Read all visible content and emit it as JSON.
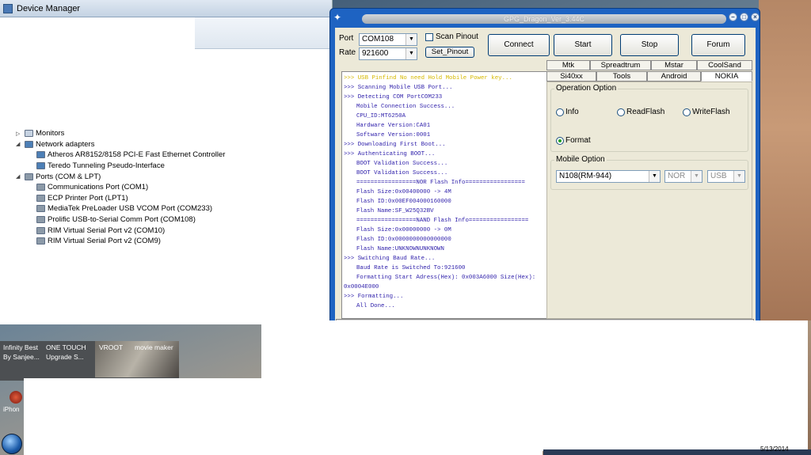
{
  "device_manager": {
    "title": "Device Manager",
    "tree": [
      {
        "label": "Monitors",
        "level": 1,
        "kind": "category",
        "icon": "monitor-icon"
      },
      {
        "label": "Network adapters",
        "level": 1,
        "kind": "category",
        "icon": "network-icon"
      },
      {
        "label": "Atheros AR8152/8158 PCI-E Fast Ethernet Controller",
        "level": 2,
        "kind": "device",
        "icon": "network-card-icon"
      },
      {
        "label": "Teredo Tunneling Pseudo-Interface",
        "level": 2,
        "kind": "device",
        "icon": "network-card-icon"
      },
      {
        "label": "Ports (COM & LPT)",
        "level": 1,
        "kind": "category",
        "icon": "port-icon"
      },
      {
        "label": "Communications Port (COM1)",
        "level": 2,
        "kind": "device",
        "icon": "port-icon"
      },
      {
        "label": "ECP Printer Port (LPT1)",
        "level": 2,
        "kind": "device",
        "icon": "port-icon"
      },
      {
        "label": "MediaTek PreLoader USB VCOM Port (COM233)",
        "level": 2,
        "kind": "device",
        "icon": "port-icon"
      },
      {
        "label": "Prolific USB-to-Serial Comm Port (COM108)",
        "level": 2,
        "kind": "device",
        "icon": "port-icon"
      },
      {
        "label": "RIM Virtual Serial Port v2 (COM10)",
        "level": 2,
        "kind": "device",
        "icon": "port-icon"
      },
      {
        "label": "RIM Virtual Serial Port v2 (COM9)",
        "level": 2,
        "kind": "device",
        "icon": "port-icon"
      }
    ]
  },
  "gpg": {
    "title": "GPG_Dragon_Ver_3.44C",
    "port_label": "Port",
    "port_value": "COM108",
    "rate_label": "Rate",
    "rate_value": "921600",
    "scan_pinout_label": "Scan Pinout",
    "set_pinout_label": "Set_Pinout",
    "buttons": {
      "connect": "Connect",
      "start": "Start",
      "stop": "Stop",
      "forum": "Forum"
    },
    "tabs_row1": [
      "Mtk",
      "Spreadtrum",
      "Mstar",
      "CoolSand"
    ],
    "tabs_row2": [
      "Si40xx",
      "Tools",
      "Android",
      "NOKIA"
    ],
    "active_tab": "NOKIA",
    "operation_option": {
      "title": "Operation Option",
      "options": [
        "Info",
        "ReadFlash",
        "WriteFlash",
        "Format"
      ],
      "selected": "Format"
    },
    "mobile_option": {
      "title": "Mobile Option",
      "model": "N108(RM-944)",
      "flash": "NOR",
      "conn": "USB"
    },
    "log": [
      {
        "text": ">>> USB Pinfind No need Hold Mobile Power key...",
        "style": "warn",
        "indent": 0
      },
      {
        "text": ">>> Scanning Mobile USB Port...",
        "style": "normal",
        "indent": 0
      },
      {
        "text": ">>> Detecting COM PortCOM233",
        "style": "normal",
        "indent": 0
      },
      {
        "text": "Mobile Connection Success...",
        "style": "normal",
        "indent": 1
      },
      {
        "text": "CPU_ID:MT6250A",
        "style": "normal",
        "indent": 1
      },
      {
        "text": "Hardware Version:CA01",
        "style": "normal",
        "indent": 1
      },
      {
        "text": "Software Version:0001",
        "style": "normal",
        "indent": 1
      },
      {
        "text": ">>> Downloading First Boot...",
        "style": "normal",
        "indent": 0
      },
      {
        "text": ">>> Authenticating BOOT...",
        "style": "normal",
        "indent": 0
      },
      {
        "text": "BOOT Validation Success...",
        "style": "normal",
        "indent": 1
      },
      {
        "text": "BOOT Validation Success...",
        "style": "normal",
        "indent": 1
      },
      {
        "text": "=================NOR Flash Info=================",
        "style": "normal",
        "indent": 1
      },
      {
        "text": "Flash Size:0x00400000 -> 4M",
        "style": "normal",
        "indent": 1
      },
      {
        "text": "Flash ID:0x00EF004000160000",
        "style": "normal",
        "indent": 1
      },
      {
        "text": "Flash Name:SF_W25Q32BV",
        "style": "normal",
        "indent": 1
      },
      {
        "text": "=================NAND Flash Info=================",
        "style": "normal",
        "indent": 1
      },
      {
        "text": "Flash Size:0x00000000 -> 0M",
        "style": "normal",
        "indent": 1
      },
      {
        "text": "Flash ID:0x0000000000000000",
        "style": "normal",
        "indent": 1
      },
      {
        "text": "Flash Name:UNKNOWNUNKNOWN",
        "style": "normal",
        "indent": 1
      },
      {
        "text": ">>> Switching Baud Rate...",
        "style": "normal",
        "indent": 0
      },
      {
        "text": " Baud Rate is Switched To:921600",
        "style": "normal",
        "indent": 1
      },
      {
        "text": "Formatting Start Adress(Hex): 0x003A6000  Size(Hex):",
        "style": "normal",
        "indent": 1
      },
      {
        "text": "0x0004E000",
        "style": "normal",
        "indent": 0
      },
      {
        "text": ">>> Formatting...",
        "style": "normal",
        "indent": 0
      },
      {
        "text": "All Done...",
        "style": "normal",
        "indent": 1
      }
    ]
  },
  "taskbar": {
    "items": [
      "Infinity Best",
      "ONE TOUCH",
      "VROOT",
      "movie maker"
    ],
    "items2": [
      "By Sanjee...",
      "Upgrade S..."
    ],
    "iphone_label": "iPhon",
    "clock": "5/13/2014"
  },
  "colors": {
    "gpg_frame": "#1e63c2",
    "log_text": "#2d1eaa",
    "log_warn": "#d6b900"
  }
}
